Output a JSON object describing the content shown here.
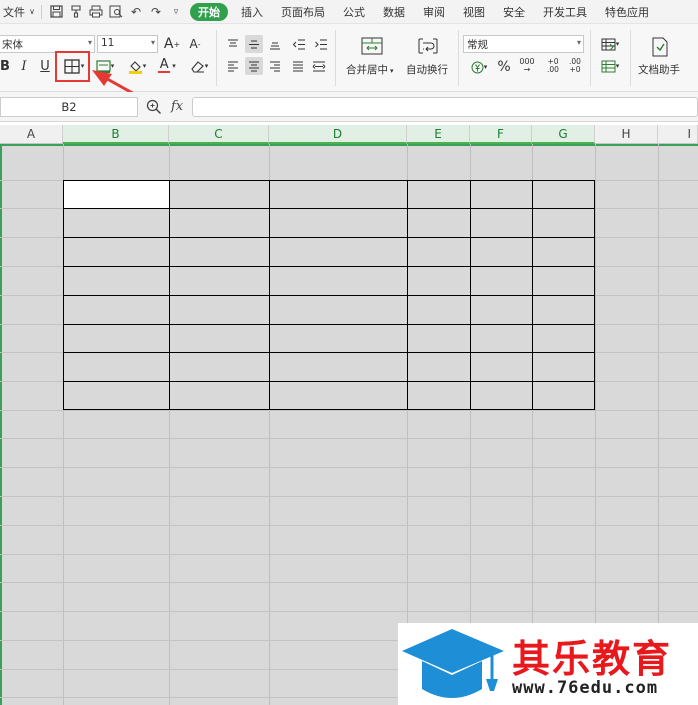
{
  "menubar": {
    "file": "文件",
    "tabs": [
      "开始",
      "插入",
      "页面布局",
      "公式",
      "数据",
      "审阅",
      "视图",
      "安全",
      "开发工具",
      "特色应用"
    ],
    "active_tab_index": 0
  },
  "ribbon": {
    "font_name": "宋体",
    "font_size": "11",
    "bold": "B",
    "italic": "I",
    "underline": "U",
    "font_color_letter": "A",
    "grow_font": "A⁺",
    "shrink_font": "A⁻",
    "merge_center": "合并居中",
    "wrap_text": "自动换行",
    "number_format": "常规",
    "percent": "%",
    "thousands": "000",
    "dec_inc": "+0 .00",
    "dec_dec": ".00 +0",
    "doc_assistant": "文档助手",
    "highlighted_tool": "border-icon"
  },
  "formula_bar": {
    "cell_ref": "B2",
    "fx": "fx",
    "formula": ""
  },
  "columns": [
    "A",
    "B",
    "C",
    "D",
    "E",
    "F",
    "G",
    "H",
    "I"
  ],
  "watermark": {
    "title": "其乐教育",
    "url": "www.76edu.com"
  },
  "colors": {
    "accent_green": "#31a04d",
    "highlight_red": "#e53935",
    "watermark_blue": "#1e8fd6"
  }
}
